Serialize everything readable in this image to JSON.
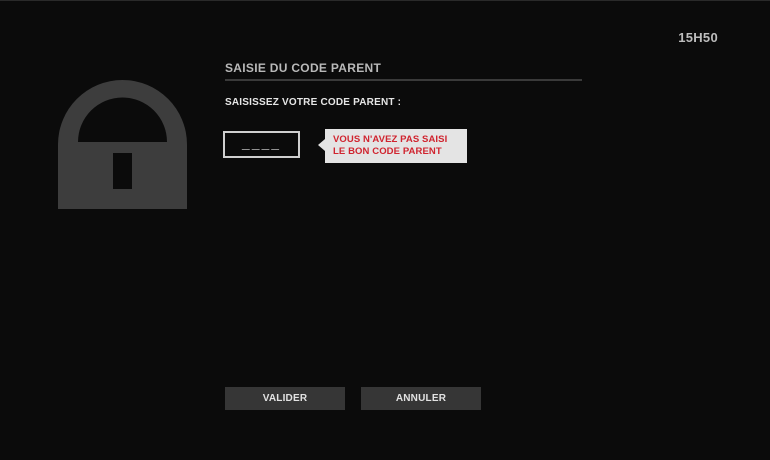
{
  "header": {
    "clock": "15H50"
  },
  "dialog": {
    "title": "SAISIE DU CODE PARENT",
    "prompt": "SAISISSEZ VOTRE CODE PARENT :",
    "code_field": {
      "placeholder": "____",
      "value": ""
    },
    "error": {
      "line1": "VOUS N'AVEZ PAS SAISI",
      "line2": "LE BON CODE PARENT",
      "color": "#d0242f"
    },
    "buttons": {
      "validate_label": "VALIDER",
      "cancel_label": "ANNULER"
    }
  },
  "icons": {
    "lock": "lock-icon"
  },
  "colors": {
    "background": "#0b0b0b",
    "lock_gray": "#3d3d3d",
    "button_bg": "#363636",
    "tooltip_bg": "#e4e4e4"
  }
}
